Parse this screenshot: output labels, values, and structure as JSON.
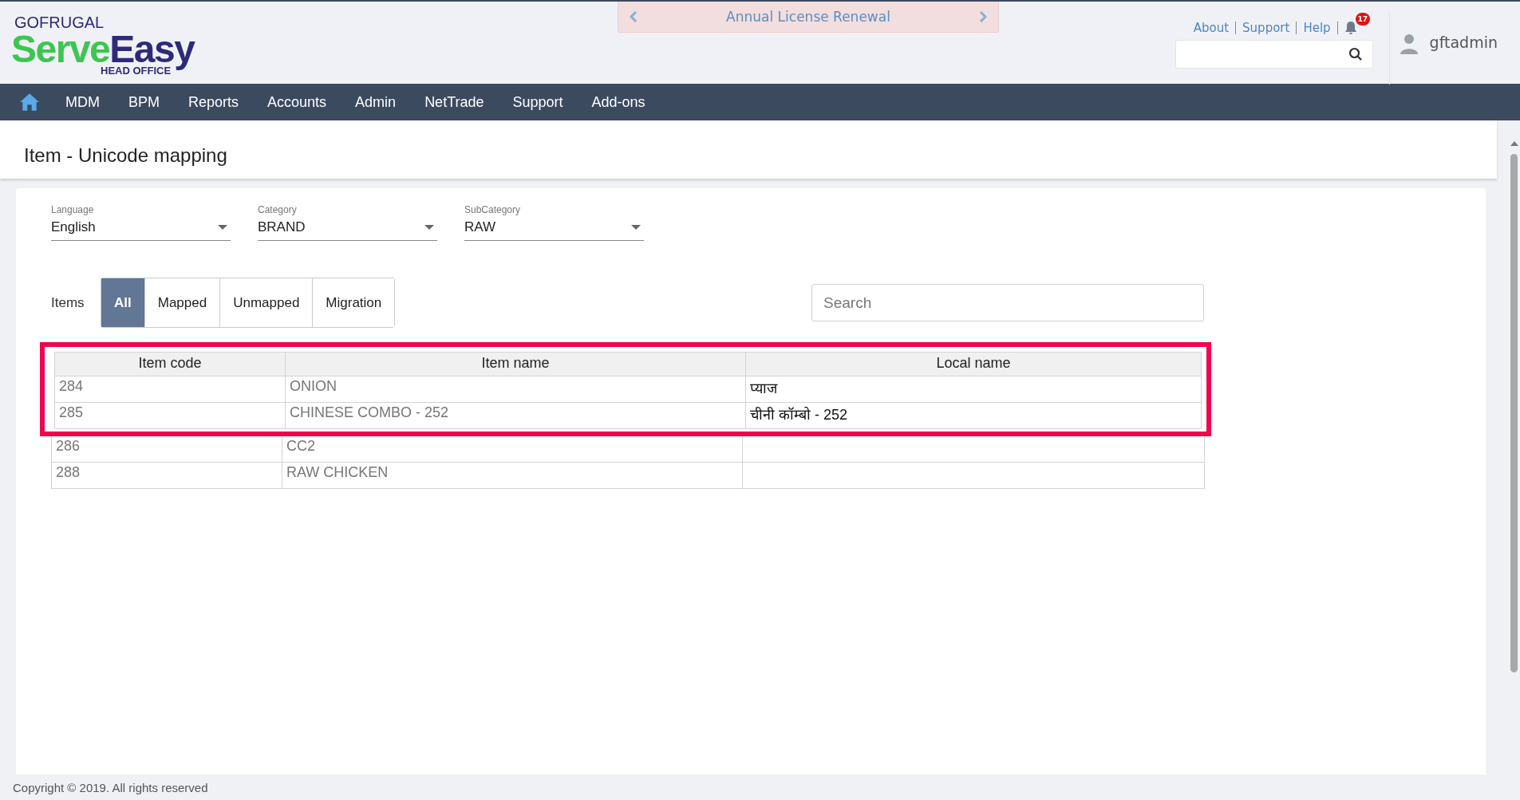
{
  "brand": {
    "company": "GOFRUGAL",
    "product_a": "Serve",
    "product_b": "Easy",
    "edition": "HEAD OFFICE"
  },
  "banner": {
    "text": "Annual License Renewal"
  },
  "top_links": [
    "About",
    "Support",
    "Help"
  ],
  "notifications": {
    "count": "17"
  },
  "user": {
    "name": "gftadmin"
  },
  "nav": [
    "MDM",
    "BPM",
    "Reports",
    "Accounts",
    "Admin",
    "NetTrade",
    "Support",
    "Add-ons"
  ],
  "page_title": "Item - Unicode mapping",
  "filters": [
    {
      "label": "Language",
      "value": "English"
    },
    {
      "label": "Category",
      "value": "BRAND"
    },
    {
      "label": "SubCategory",
      "value": "RAW"
    }
  ],
  "items_label": "Items",
  "segments": [
    {
      "label": "All",
      "selected": true
    },
    {
      "label": "Mapped",
      "selected": false
    },
    {
      "label": "Unmapped",
      "selected": false
    },
    {
      "label": "Migration",
      "selected": false
    }
  ],
  "search": {
    "placeholder": "Search"
  },
  "table": {
    "columns": [
      "Item code",
      "Item name",
      "Local name"
    ],
    "rows": [
      {
        "cells": [
          "284",
          "ONION",
          "प्याज"
        ],
        "highlighted": true
      },
      {
        "cells": [
          "285",
          "CHINESE COMBO - 252",
          "चीनी कॉम्बो - 252"
        ],
        "highlighted": true
      },
      {
        "cells": [
          "286",
          "CC2",
          ""
        ],
        "highlighted": false
      },
      {
        "cells": [
          "288",
          "RAW CHICKEN",
          ""
        ],
        "highlighted": false
      }
    ]
  },
  "footer": "Copyright © 2019. All rights reserved"
}
